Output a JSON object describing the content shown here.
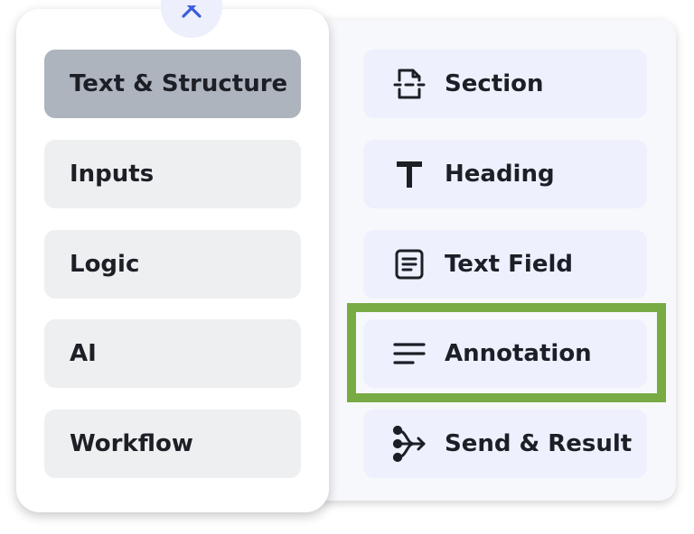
{
  "close": {
    "icon": "close-icon"
  },
  "categories": [
    {
      "label": "Text & Structure",
      "active": true
    },
    {
      "label": "Inputs",
      "active": false
    },
    {
      "label": "Logic",
      "active": false
    },
    {
      "label": "AI",
      "active": false
    },
    {
      "label": "Workflow",
      "active": false
    }
  ],
  "items": [
    {
      "label": "Section",
      "icon": "section-icon"
    },
    {
      "label": "Heading",
      "icon": "heading-icon"
    },
    {
      "label": "Text Field",
      "icon": "text-field-icon"
    },
    {
      "label": "Annotation",
      "icon": "annotation-icon",
      "highlighted": true
    },
    {
      "label": "Send & Result",
      "icon": "send-result-icon"
    }
  ],
  "colors": {
    "highlight_border": "#79ab45",
    "active_category": "#aeb4be",
    "item_background": "#eef0fd",
    "close_icon": "#3b5bdb"
  }
}
